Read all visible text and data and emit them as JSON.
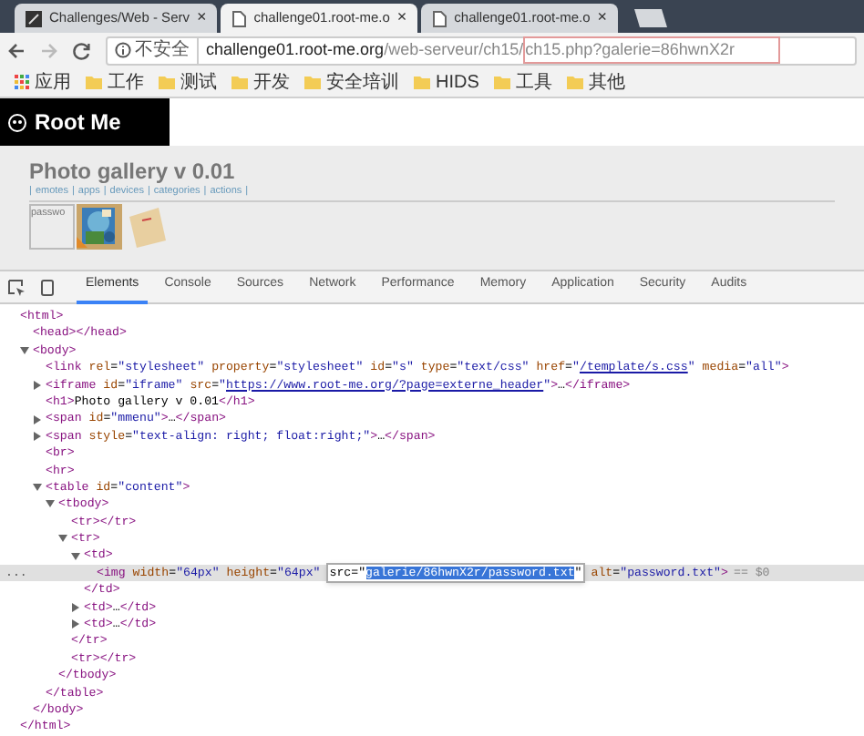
{
  "tabs": [
    {
      "title": "Challenges/Web - Serv",
      "kind": "site",
      "selected": false,
      "close": "×"
    },
    {
      "title": "challenge01.root-me.o",
      "kind": "page",
      "selected": true,
      "close": "×"
    },
    {
      "title": "challenge01.root-me.o",
      "kind": "page",
      "selected": false,
      "close": "×"
    }
  ],
  "address_bar": {
    "security": "不安全",
    "host": "challenge01.root-me.org",
    "path": "/web-serveur/ch15/",
    "highlighted": "ch15.php?galerie=86hwnX2r"
  },
  "bookmarks": [
    {
      "label": "应用",
      "kind": "apps"
    },
    {
      "label": "工作",
      "kind": "folder"
    },
    {
      "label": "测试",
      "kind": "folder"
    },
    {
      "label": "开发",
      "kind": "folder"
    },
    {
      "label": "安全培训",
      "kind": "folder"
    },
    {
      "label": "HIDS",
      "kind": "folder"
    },
    {
      "label": "工具",
      "kind": "folder"
    },
    {
      "label": "其他",
      "kind": "folder"
    }
  ],
  "page": {
    "logo": "Root Me",
    "title": "Photo gallery v 0.01",
    "menu_separator": "|",
    "menu": [
      "emotes",
      "apps",
      "devices",
      "categories",
      "actions"
    ],
    "gallery": [
      {
        "kind": "broken",
        "alt": "passwo"
      },
      {
        "kind": "picture"
      },
      {
        "kind": "envelope"
      }
    ]
  },
  "devtools": {
    "tabs": [
      {
        "label": "Elements",
        "selected": true
      },
      {
        "label": "Console",
        "selected": false
      },
      {
        "label": "Sources",
        "selected": false
      },
      {
        "label": "Network",
        "selected": false
      },
      {
        "label": "Performance",
        "selected": false
      },
      {
        "label": "Memory",
        "selected": false
      },
      {
        "label": "Application",
        "selected": false
      },
      {
        "label": "Security",
        "selected": false
      },
      {
        "label": "Audits",
        "selected": false
      }
    ],
    "dom_tree": [
      {
        "text": "<html>",
        "kind": "plain",
        "selected": false,
        "close": "</html>",
        "children": [
          {
            "text": "<head></head>",
            "kind": "plain",
            "selected": false
          },
          {
            "text": "<body>",
            "kind": "expanded",
            "selected": false,
            "close": "</body>",
            "children": [
              {
                "text": "<link rel=\"stylesheet\" property=\"stylesheet\" id=\"s\" type=\"text/css\" href=\"/template/s.css\" media=\"all\">",
                "kind": "plain",
                "selected": false
              },
              {
                "text": "<iframe id=\"iframe\" src=\"https://www.root-me.org/?page=externe_header\">…</iframe>",
                "kind": "collapsed",
                "selected": false
              },
              {
                "text": "<h1>Photo gallery v 0.01</h1>",
                "kind": "plain",
                "selected": false
              },
              {
                "text": "<span id=\"mmenu\">…</span>",
                "kind": "collapsed",
                "selected": false
              },
              {
                "text": "<span style=\"text-align: right; float:right;\">…</span>",
                "kind": "collapsed",
                "selected": false
              },
              {
                "text": "<br>",
                "kind": "plain",
                "selected": false
              },
              {
                "text": "<hr>",
                "kind": "plain",
                "selected": false
              },
              {
                "text": "<table id=\"content\">",
                "kind": "expanded",
                "selected": false,
                "close": "</table>",
                "children": [
                  {
                    "text": "<tbody>",
                    "kind": "expanded",
                    "selected": false,
                    "close": "</tbody>",
                    "children": [
                      {
                        "text": "<tr></tr>",
                        "kind": "plain",
                        "selected": false
                      },
                      {
                        "text": "<tr>",
                        "kind": "expanded",
                        "selected": false,
                        "close": "</tr>",
                        "children": [
                          {
                            "text": "<td>",
                            "kind": "expanded",
                            "selected": false,
                            "close": "</td>",
                            "children": [
                              {
                                "text": "<img width=\"64px\" height=\"64px\"",
                                "kind": "plain",
                                "selected": true,
                                "marker": "...",
                                "edit_field": {
                                  "prefix": "src=\"",
                                  "selection": "galerie/86hwnX2r/password.txt",
                                  "suffix": "\""
                                },
                                "after": "alt=\"password.txt\">",
                                "badge": "== $0"
                              }
                            ]
                          },
                          {
                            "text": "<td>…</td>",
                            "kind": "collapsed",
                            "selected": false
                          },
                          {
                            "text": "<td>…</td>",
                            "kind": "collapsed",
                            "selected": false
                          }
                        ]
                      },
                      {
                        "text": "<tr></tr>",
                        "kind": "plain",
                        "selected": false
                      }
                    ]
                  }
                ]
              }
            ]
          }
        ]
      }
    ]
  }
}
